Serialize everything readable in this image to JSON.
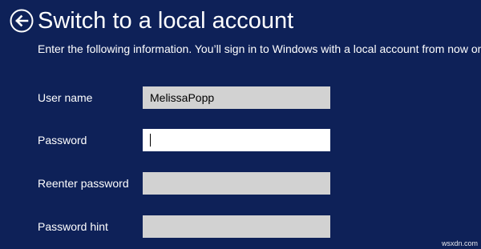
{
  "header": {
    "title": "Switch to a local account",
    "back_icon": "back-arrow-circle-icon"
  },
  "instruction": "Enter the following information. You’ll sign in to Windows with a local account from now on.",
  "form": {
    "username": {
      "label": "User name",
      "value": "MelissaPopp"
    },
    "password": {
      "label": "Password",
      "value": ""
    },
    "reenter_password": {
      "label": "Reenter password",
      "value": ""
    },
    "password_hint": {
      "label": "Password hint",
      "value": ""
    }
  },
  "watermark": "wsxdn.com",
  "colors": {
    "background": "#0e2158",
    "text": "#ffffff",
    "input_inactive": "#d2d2d2",
    "input_active": "#ffffff"
  }
}
